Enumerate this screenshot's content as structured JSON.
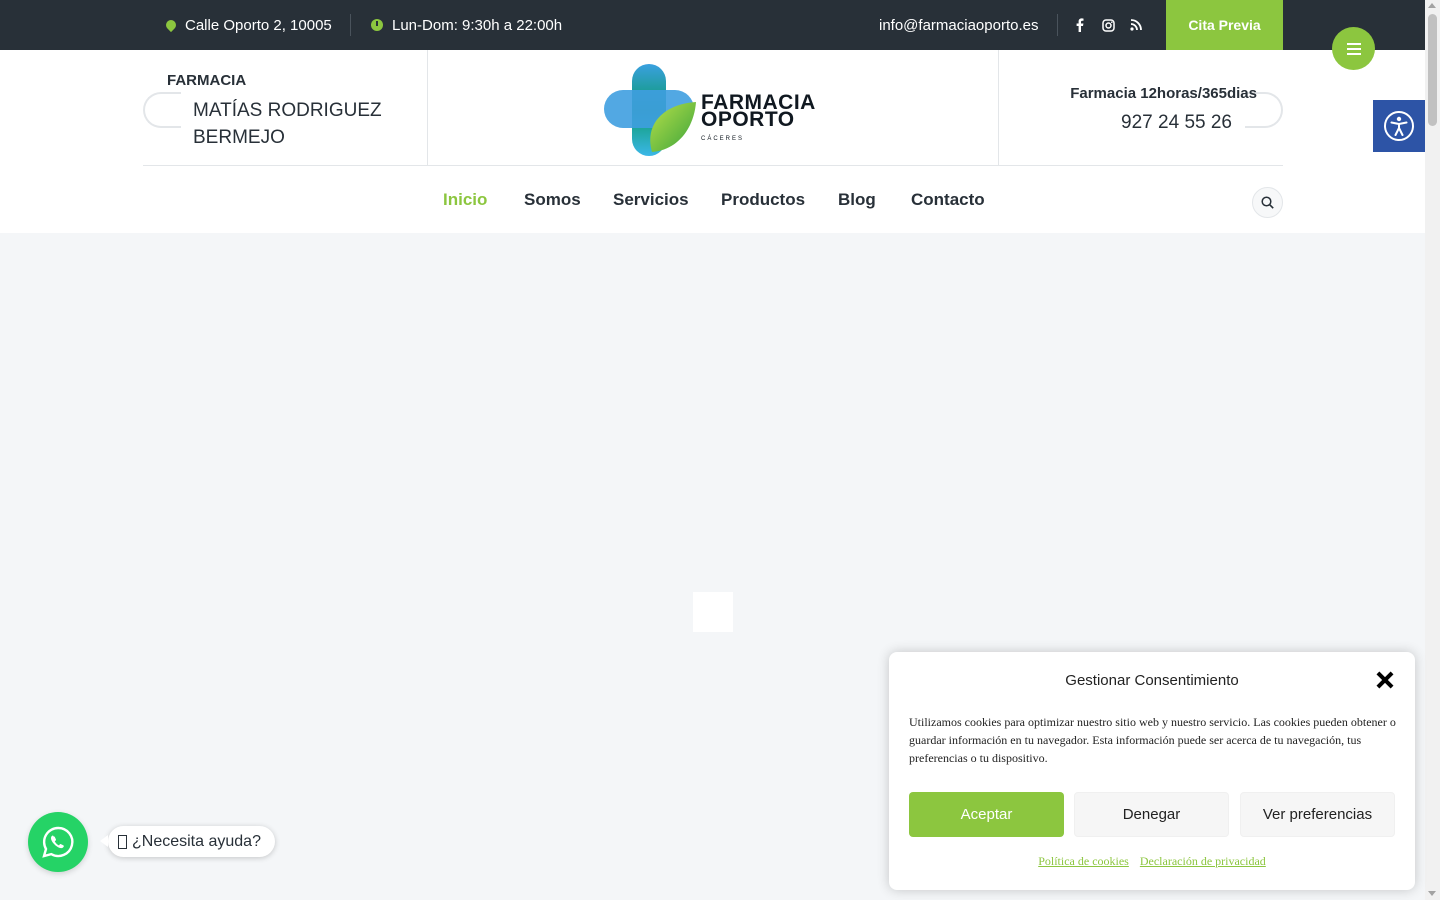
{
  "colors": {
    "accent": "#8cc63f",
    "topbar": "#283038",
    "accessibility": "#2d54a6",
    "whatsapp": "#25d366"
  },
  "topbar": {
    "address": "Calle Oporto 2, 10005",
    "hours": "Lun-Dom: 9:30h a 22:00h",
    "email": "info@farmaciaoporto.es",
    "social_icons": [
      "facebook-icon",
      "instagram-icon",
      "rss-icon"
    ],
    "cta_label": "Cita Previa"
  },
  "header": {
    "left_label": "FARMACIA",
    "left_name": "MATÍAS RODRIGUEZ BERMEJO",
    "logo_line1": "FARMACIA",
    "logo_line2": "OPORTO",
    "logo_line3": "CÁCERES",
    "right_label": "Farmacia 12horas/365dias",
    "phone": "927 24 55 26"
  },
  "nav": {
    "items": [
      {
        "label": "Inicio",
        "active": true
      },
      {
        "label": "Somos"
      },
      {
        "label": "Servicios"
      },
      {
        "label": "Productos"
      },
      {
        "label": "Blog"
      },
      {
        "label": "Contacto"
      }
    ]
  },
  "whatsapp": {
    "label": "¿Necesita ayuda?"
  },
  "consent": {
    "title": "Gestionar Consentimiento",
    "text": "Utilizamos cookies para optimizar nuestro sitio web y nuestro servicio. Las cookies pueden obtener o guardar información en tu navegador. Esta información puede ser acerca de tu navegación, tus preferencias o tu dispositivo.",
    "accept": "Aceptar",
    "deny": "Denegar",
    "preferences": "Ver preferencias",
    "link_cookies": "Política de cookies",
    "link_privacy": "Declaración de privacidad"
  }
}
